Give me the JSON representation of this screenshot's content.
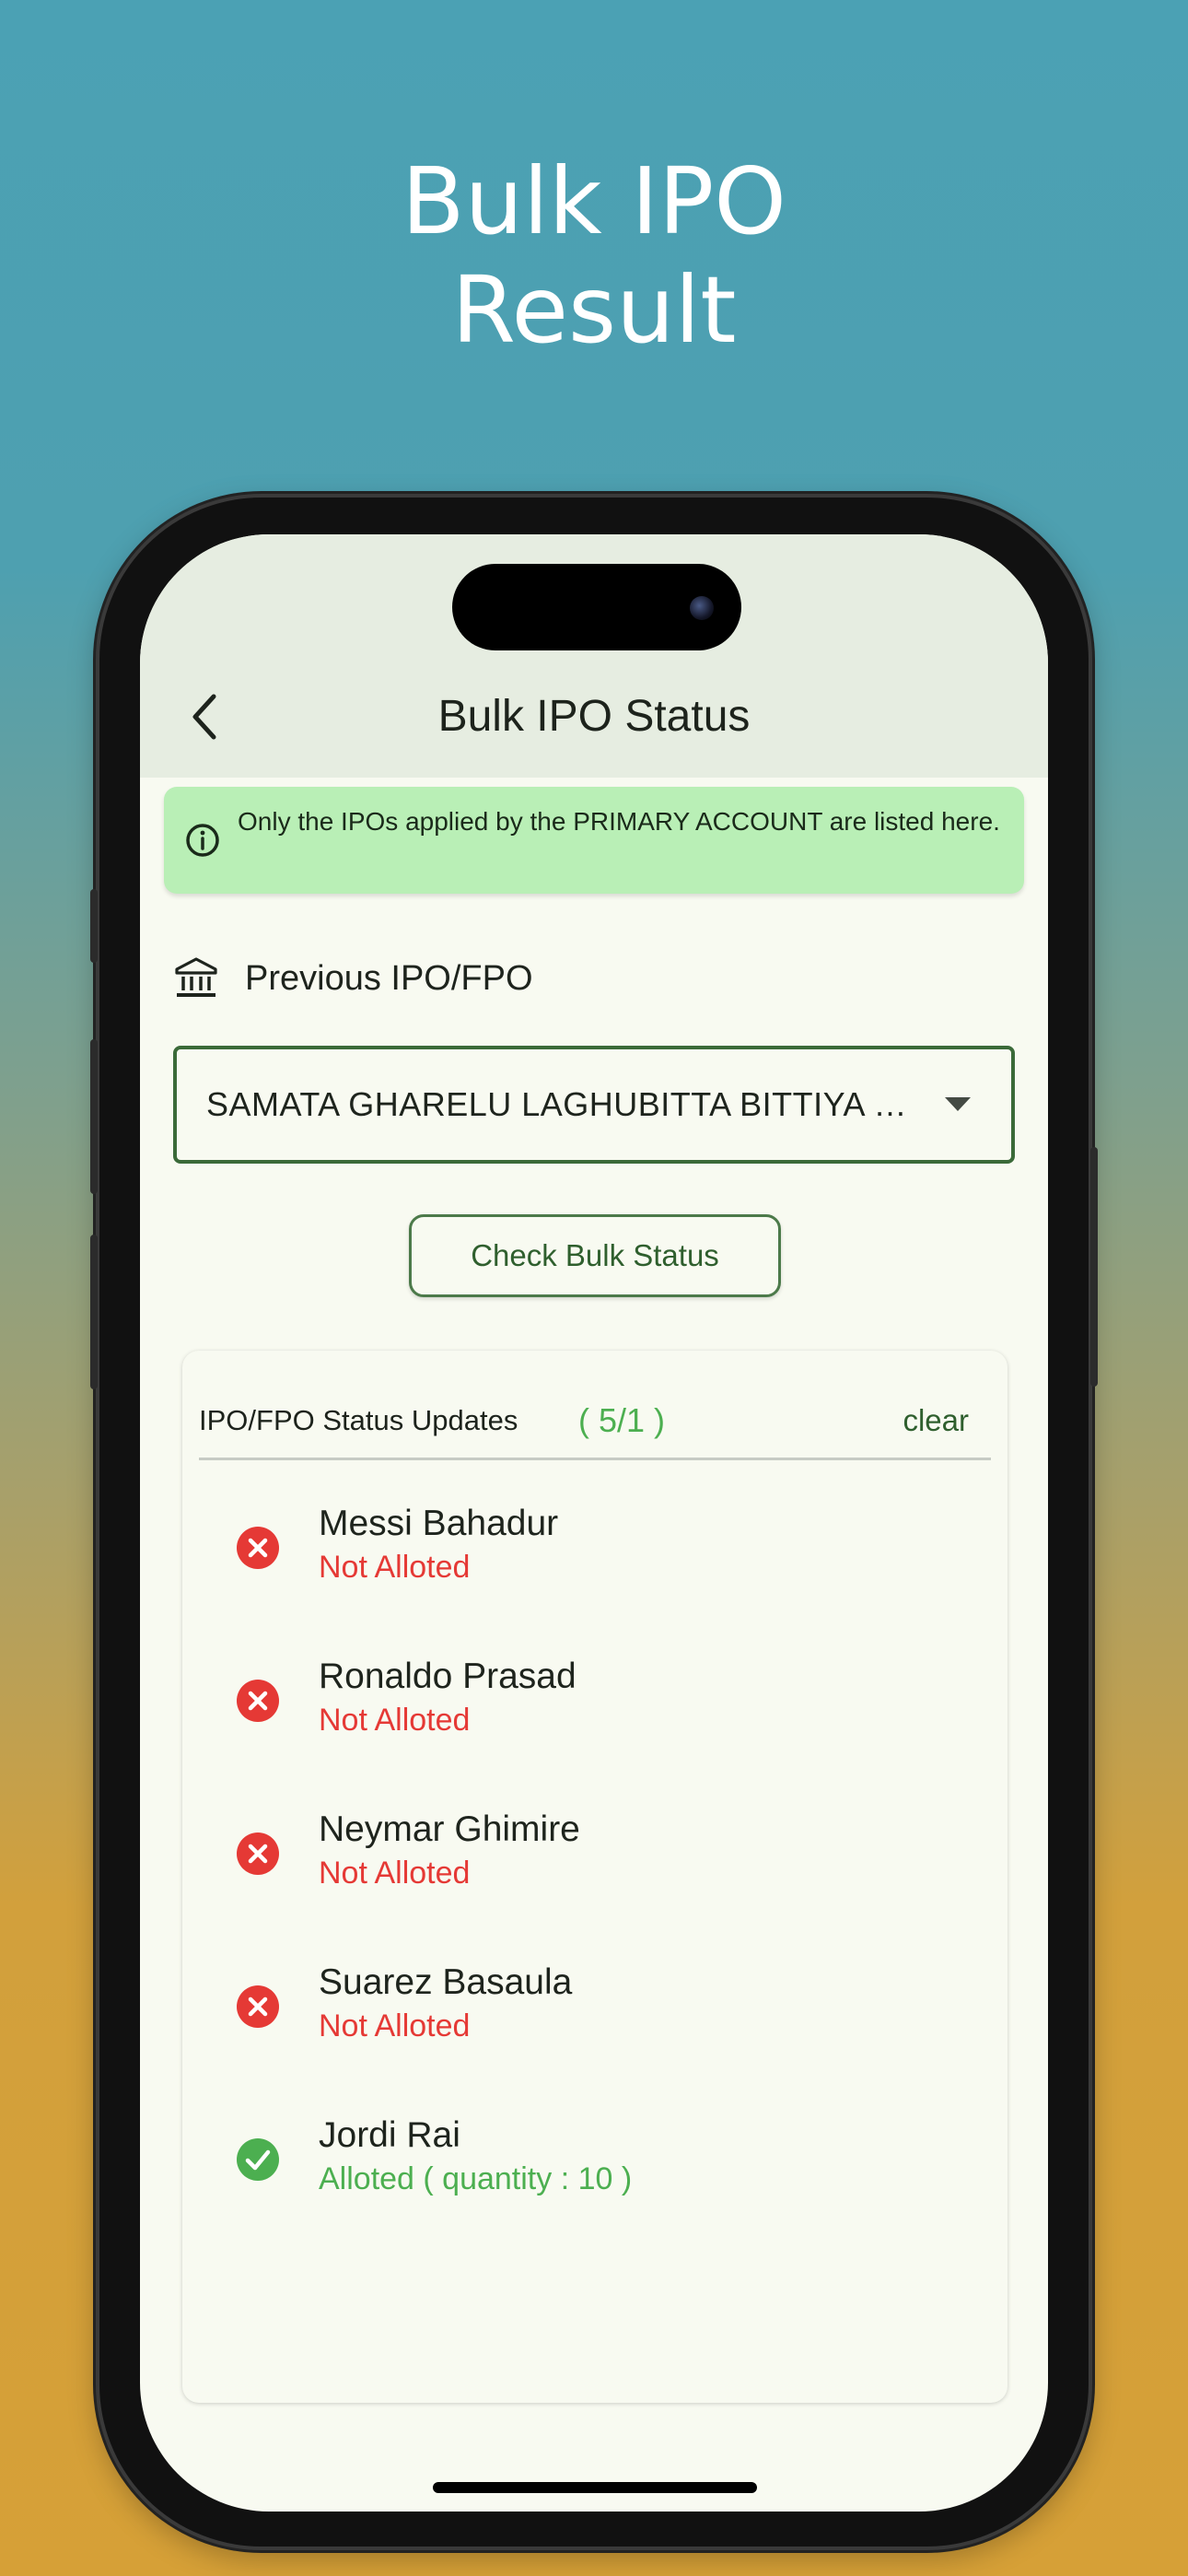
{
  "promo": {
    "title_line1": "Bulk IPO",
    "title_line2": "Result"
  },
  "app_bar": {
    "title": "Bulk IPO Status",
    "back_icon": "chevron-left-icon"
  },
  "notice": {
    "icon": "info-icon",
    "text": "Only the IPOs applied by the PRIMARY ACCOUNT are listed here."
  },
  "section": {
    "icon": "bank-icon",
    "label": "Previous IPO/FPO"
  },
  "ipo_select": {
    "value": "SAMATA GHARELU LAGHUBITTA BITTIYA S...",
    "caret_icon": "dropdown-arrow-icon"
  },
  "check_button": {
    "label": "Check Bulk Status"
  },
  "status_card": {
    "title": "IPO/FPO Status Updates",
    "count": "( 5/1 )",
    "clear_label": "clear",
    "results": [
      {
        "name": "Messi Bahadur",
        "status": "Not Alloted",
        "allotted": false,
        "icon": "cancel-icon"
      },
      {
        "name": "Ronaldo Prasad",
        "status": "Not Alloted",
        "allotted": false,
        "icon": "cancel-icon"
      },
      {
        "name": "Neymar Ghimire",
        "status": "Not Alloted",
        "allotted": false,
        "icon": "cancel-icon"
      },
      {
        "name": "Suarez Basaula",
        "status": "Not Alloted",
        "allotted": false,
        "icon": "cancel-icon"
      },
      {
        "name": "Jordi Rai",
        "status": "Alloted ( quantity : 10 )",
        "allotted": true,
        "icon": "check-circle-icon"
      }
    ]
  },
  "colors": {
    "primary_green": "#3b6a39",
    "success_green": "#4caf50",
    "error_red": "#e53935",
    "notice_bg": "#b9efb6",
    "app_bar_bg": "#e6ede1",
    "screen_bg": "#f8faf1"
  }
}
